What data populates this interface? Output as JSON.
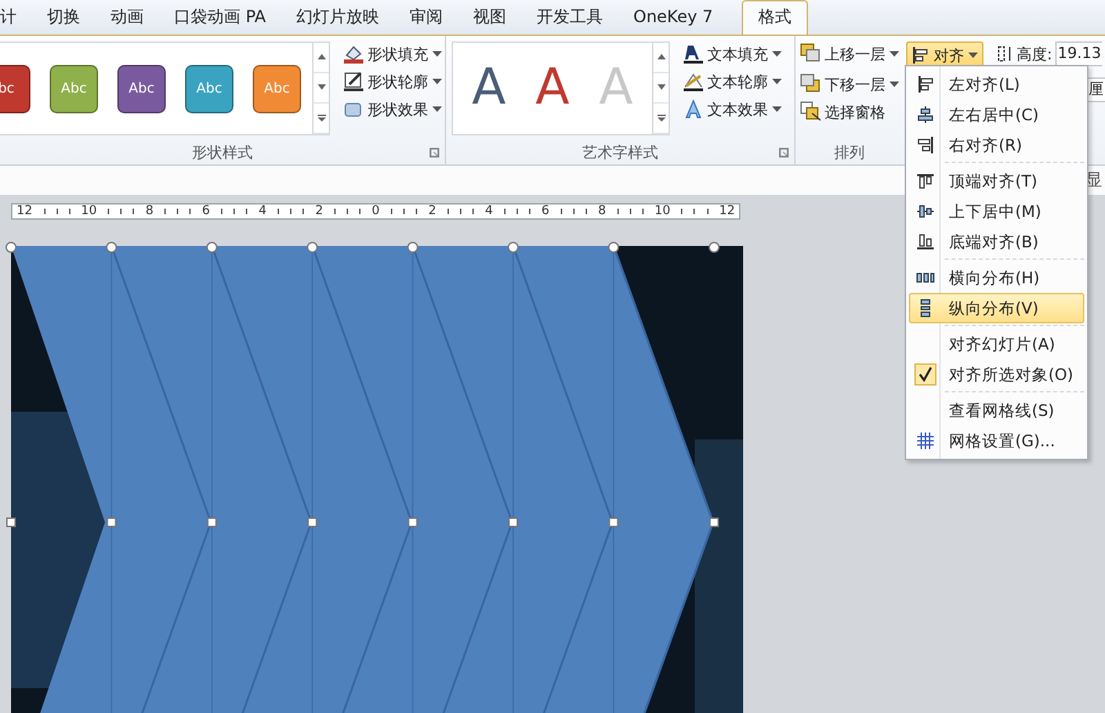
{
  "tabs": [
    {
      "label": "计",
      "selected": false
    },
    {
      "label": "切换",
      "selected": false
    },
    {
      "label": "动画",
      "selected": false
    },
    {
      "label": "口袋动画 PA",
      "selected": false
    },
    {
      "label": "幻灯片放映",
      "selected": false
    },
    {
      "label": "审阅",
      "selected": false
    },
    {
      "label": "视图",
      "selected": false
    },
    {
      "label": "开发工具",
      "selected": false
    },
    {
      "label": "OneKey 7",
      "selected": false
    },
    {
      "label": "格式",
      "selected": true
    }
  ],
  "shape_styles": {
    "label": "形状样式",
    "swatches": [
      {
        "text": "bc",
        "color": "#c0392f"
      },
      {
        "text": "Abc",
        "color": "#8fb04a"
      },
      {
        "text": "Abc",
        "color": "#7a5a9e"
      },
      {
        "text": "Abc",
        "color": "#3aa3c0"
      },
      {
        "text": "Abc",
        "color": "#f08a34"
      }
    ],
    "commands": [
      {
        "label": "形状填充",
        "kind": "fill"
      },
      {
        "label": "形状轮廓",
        "kind": "outline"
      },
      {
        "label": "形状效果",
        "kind": "effect"
      }
    ]
  },
  "wordart_styles": {
    "label": "艺术字样式",
    "letters": [
      {
        "text": "A",
        "color": "#4a5e78"
      },
      {
        "text": "A",
        "color": "#c0392f"
      },
      {
        "text": "A",
        "color": "#c8c8c8"
      }
    ],
    "commands": [
      {
        "label": "文本填充",
        "kind": "fill"
      },
      {
        "label": "文本轮廓",
        "kind": "outline"
      },
      {
        "label": "文本效果",
        "kind": "effect"
      }
    ]
  },
  "arrange": {
    "label": "排列",
    "commands": [
      {
        "label": "上移一层",
        "kind": "forward"
      },
      {
        "label": "下移一层",
        "kind": "backward"
      },
      {
        "label": "选择窗格",
        "kind": "pane"
      }
    ],
    "align_button": {
      "label": "对齐",
      "active": true
    }
  },
  "size": {
    "label": "高度:",
    "value": "19.13",
    "unit": "厘"
  },
  "edge_text": "显",
  "ruler": {
    "labels": [
      "12",
      "10",
      "8",
      "6",
      "4",
      "2",
      "0",
      "2",
      "4",
      "6",
      "8",
      "10",
      "12"
    ]
  },
  "align_menu": {
    "groups": [
      {
        "items": [
          {
            "label": "左对齐(L)",
            "kind": "left",
            "selected": false,
            "checked": false
          },
          {
            "label": "左右居中(C)",
            "kind": "center",
            "selected": false,
            "checked": false
          },
          {
            "label": "右对齐(R)",
            "kind": "right",
            "selected": false,
            "checked": false
          }
        ]
      },
      {
        "items": [
          {
            "label": "顶端对齐(T)",
            "kind": "top",
            "selected": false,
            "checked": false
          },
          {
            "label": "上下居中(M)",
            "kind": "middle",
            "selected": false,
            "checked": false
          },
          {
            "label": "底端对齐(B)",
            "kind": "bottom",
            "selected": false,
            "checked": false
          }
        ]
      },
      {
        "items": [
          {
            "label": "横向分布(H)",
            "kind": "hdist",
            "selected": false,
            "checked": false
          },
          {
            "label": "纵向分布(V)",
            "kind": "vdist",
            "selected": true,
            "checked": false
          }
        ]
      },
      {
        "items": [
          {
            "label": "对齐幻灯片(A)",
            "kind": "none",
            "selected": false,
            "checked": false
          },
          {
            "label": "对齐所选对象(O)",
            "kind": "none",
            "selected": false,
            "checked": true
          }
        ]
      },
      {
        "items": [
          {
            "label": "查看网格线(S)",
            "kind": "none",
            "selected": false,
            "checked": false
          },
          {
            "label": "网格设置(G)...",
            "kind": "grid",
            "selected": false,
            "checked": false
          }
        ]
      }
    ]
  }
}
